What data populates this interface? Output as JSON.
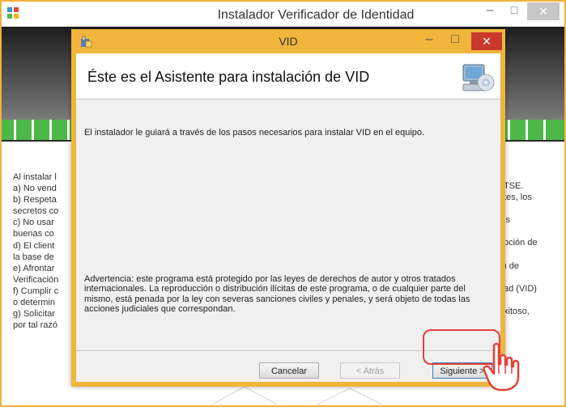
{
  "back_window": {
    "title": "Instalador Verificador de Identidad",
    "minimize_glyph": "–",
    "maximize_glyph": "□",
    "close_glyph": "✕",
    "left_text": "Al instalar l\na) No vend\nb) Respeta\nsecretos co\nc) No usar\nbuenas co\nd) El client\nla base de\ne) Afrontar\nVerificación\nf) Cumplir c\no determin\ng) Solicitar\npor tal razó",
    "right_text": "TSE.\ntes, los\n\nis\n\npción de\n\n) de\n\nad (VID)\n\nxitoso,",
    "stripe_color": "#4db847"
  },
  "dialog": {
    "title": "VID",
    "minimize_glyph": "–",
    "maximize_glyph": "□",
    "close_glyph": "✕",
    "heading": "Éste es el Asistente para instalación de VID",
    "intro": "El instalador le guiará a través de los pasos necesarios para instalar VID en el equipo.",
    "warning": "Advertencia: este programa está protegido por las leyes de derechos de autor y otros tratados internacionales. La reproducción o distribución ilícitas de este programa, o de cualquier parte del mismo, está penada por la ley con severas sanciones civiles y penales, y será objeto de todas las acciones judiciales que correspondan.",
    "buttons": {
      "cancel": "Cancelar",
      "back": "< Atrás",
      "next": "Siguiente >"
    },
    "frame_color": "#f0b53a",
    "close_color": "#c8382b"
  },
  "annotation": {
    "highlight_color": "#e84038",
    "cursor_icon": "hand-pointer-icon"
  }
}
